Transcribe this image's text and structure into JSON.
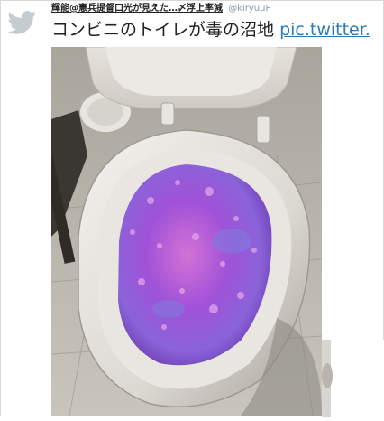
{
  "tweet": {
    "author_name": "輝能@憲兵提督口光が見えた…〆浮上率減",
    "author_handle": "@kiryuuP",
    "text": "コンビニのトイレが毒の沼地",
    "link_text": "pic.twitter."
  },
  "icons": {
    "brand": "twitter-bird-icon"
  },
  "colors": {
    "link": "#2b7bb9",
    "water_purple": "#9b4bd6",
    "water_pink": "#d160c9",
    "water_blue": "#7f7ddf"
  }
}
